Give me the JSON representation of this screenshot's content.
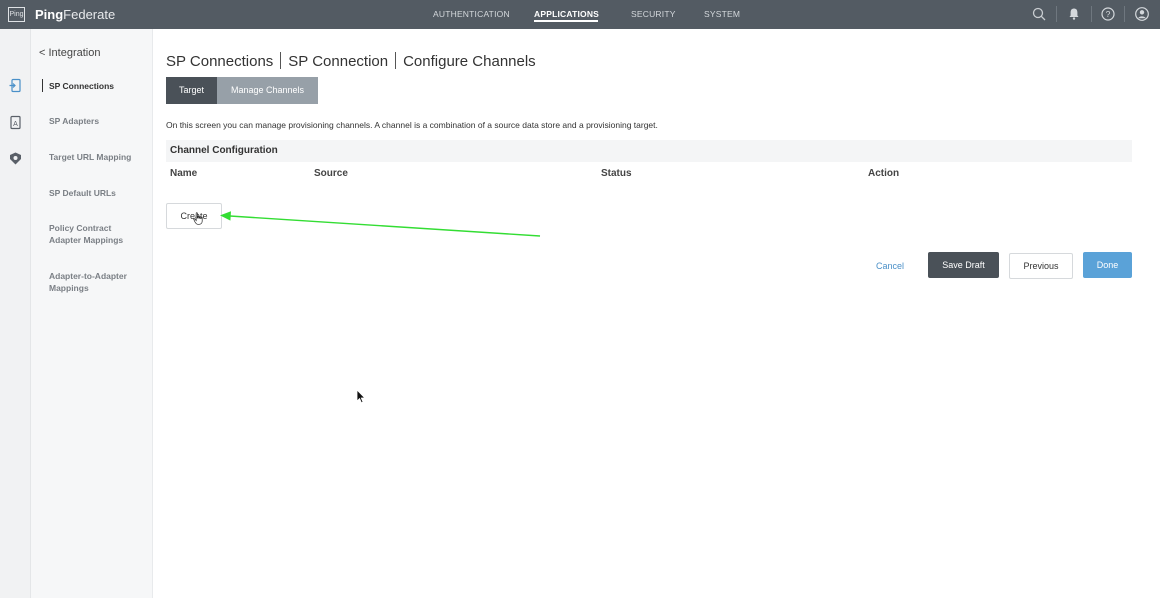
{
  "header": {
    "logo_text": "Ping",
    "brand_bold": "Ping",
    "brand_light": "Federate",
    "nav": [
      {
        "label": "AUTHENTICATION",
        "active": false
      },
      {
        "label": "APPLICATIONS",
        "active": true
      },
      {
        "label": "SECURITY",
        "active": false
      },
      {
        "label": "SYSTEM",
        "active": false
      }
    ],
    "icons": [
      "search-icon",
      "bell-icon",
      "help-icon",
      "user-icon"
    ]
  },
  "rail": {
    "icons": [
      "applications-rail-icon",
      "document-rail-icon",
      "oauth-rail-icon"
    ]
  },
  "sidebar": {
    "back_label": "< Integration",
    "items": [
      {
        "label": "SP Connections",
        "active": true
      },
      {
        "label": "SP Adapters",
        "active": false
      },
      {
        "label": "Target URL Mapping",
        "active": false
      },
      {
        "label": "SP Default URLs",
        "active": false
      },
      {
        "label": "Policy Contract Adapter Mappings",
        "active": false
      },
      {
        "label": "Adapter-to-Adapter Mappings",
        "active": false
      }
    ]
  },
  "main": {
    "breadcrumb": [
      "SP Connections",
      "SP Connection",
      "Configure Channels"
    ],
    "tabs": [
      {
        "label": "Target",
        "active": true
      },
      {
        "label": "Manage Channels",
        "active": false
      }
    ],
    "description": "On this screen you can manage provisioning channels. A channel is a combination of a source data store and a provisioning target.",
    "section_title": "Channel Configuration",
    "columns": [
      "Name",
      "Source",
      "Status",
      "Action"
    ],
    "create_label": "Create",
    "actions": {
      "cancel": "Cancel",
      "save_draft": "Save Draft",
      "previous": "Previous",
      "done": "Done"
    }
  },
  "colors": {
    "topbar": "#535b63",
    "primary_dark": "#4a5158",
    "done_blue": "#5aa2d8",
    "link_blue": "#4a90c8",
    "annotation_arrow": "#33dd33"
  }
}
